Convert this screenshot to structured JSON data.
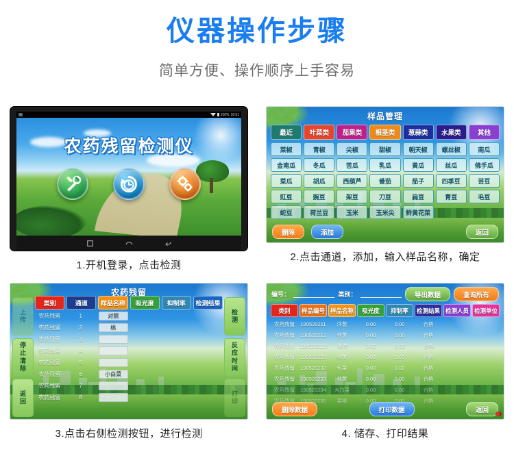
{
  "header": {
    "title": "仪器操作步骤",
    "subtitle": "简单方便、操作顺序上手容易",
    "title_color": "#1a7ef0"
  },
  "panel1": {
    "caption": "1.开机登录，点击检测",
    "screen_title": "农药残留检测仪",
    "status": {
      "battery": "100%",
      "time": "16:01"
    },
    "icons": [
      {
        "name": "tools-icon",
        "color": "#1f9a4a"
      },
      {
        "name": "history-clock-icon",
        "color": "#0c7fc4"
      },
      {
        "name": "settings-gears-icon",
        "color": "#e06c12"
      }
    ],
    "navbar": [
      "recents-icon",
      "home-icon",
      "back-icon"
    ]
  },
  "panel2": {
    "caption": "2.点击通道，添加，输入样品名称，确定",
    "title": "样品管理",
    "tabs": [
      {
        "label": "最近",
        "color": "#1f7a6e"
      },
      {
        "label": "叶菜类",
        "color": "#e8442c"
      },
      {
        "label": "茄果类",
        "color": "#c01f8a"
      },
      {
        "label": "根茎类",
        "color": "#f08a17"
      },
      {
        "label": "葱蒜类",
        "color": "#1b2f9e"
      },
      {
        "label": "水果类",
        "color": "#2a1b8e"
      },
      {
        "label": "其他",
        "color": "#8a3fd1"
      }
    ],
    "samples": [
      "菜椒",
      "青椒",
      "尖椒",
      "甜椒",
      "朝天椒",
      "螺丝椒",
      "南瓜",
      "金南瓜",
      "冬瓜",
      "苦瓜",
      "乳瓜",
      "黄瓜",
      "丝瓜",
      "佛手瓜",
      "菜瓜",
      "胡瓜",
      "西葫芦",
      "番茄",
      "茄子",
      "四季豆",
      "芸豆",
      "豇豆",
      "豌豆",
      "架豆",
      "刀豆",
      "扁豆",
      "青豆",
      "毛豆",
      "蛇豆",
      "荷兰豆",
      "玉米",
      "玉米尖",
      "鲜黄花菜"
    ],
    "buttons": {
      "delete": "删除",
      "add": "添加",
      "back": "返回"
    }
  },
  "panel3": {
    "caption": "3.点击右侧检测按钮，进行检测",
    "title": "农药残留",
    "left_buttons": [
      {
        "label": "上传",
        "faded": true
      },
      {
        "label": "停止清除",
        "faded": false
      },
      {
        "label": "返回",
        "faded": false
      }
    ],
    "right_buttons": [
      {
        "label": "检测",
        "faded": false
      },
      {
        "label": "反应时间",
        "faded": false
      },
      {
        "label": "打印",
        "faded": true
      }
    ],
    "headers": [
      {
        "label": "类别",
        "color": "#e2261c"
      },
      {
        "label": "通道",
        "color": "#1b3d8f"
      },
      {
        "label": "样品名称",
        "color": "#f29116"
      },
      {
        "label": "吸光度",
        "color": "#36a03c"
      },
      {
        "label": "抑制率",
        "color": "#2f87b5"
      },
      {
        "label": "检测结果",
        "color": "#1866c4"
      }
    ],
    "rows": [
      {
        "category": "农药残留",
        "channel": "1",
        "sample": "对照",
        "absorbance": "",
        "inhibition": "",
        "result": ""
      },
      {
        "category": "农药残留",
        "channel": "2",
        "sample": "桃",
        "absorbance": "",
        "inhibition": "",
        "result": ""
      },
      {
        "category": "农药残留",
        "channel": "3",
        "sample": "",
        "absorbance": "",
        "inhibition": "",
        "result": ""
      },
      {
        "category": "农药残留",
        "channel": "4",
        "sample": "",
        "absorbance": "",
        "inhibition": "",
        "result": ""
      },
      {
        "category": "农药残留",
        "channel": "5",
        "sample": "",
        "absorbance": "",
        "inhibition": "",
        "result": ""
      },
      {
        "category": "农药残留",
        "channel": "6",
        "sample": "小白菜",
        "absorbance": "",
        "inhibition": "",
        "result": ""
      },
      {
        "category": "农药残留",
        "channel": "7",
        "sample": "",
        "absorbance": "",
        "inhibition": "",
        "result": ""
      },
      {
        "category": "农药残留",
        "channel": "8",
        "sample": "",
        "absorbance": "",
        "inhibition": "",
        "result": ""
      }
    ]
  },
  "panel4": {
    "caption": "4. 储存、打印结果",
    "filters": {
      "number_label": "编号：",
      "number_value": "",
      "category_label": "类别：",
      "category_value": ""
    },
    "top_buttons": {
      "export": "导出数据",
      "query_all": "查询所有"
    },
    "headers": [
      {
        "label": "类别",
        "color": "#e2261c"
      },
      {
        "label": "样品编号",
        "color": "#e8711a"
      },
      {
        "label": "样品名称",
        "color": "#f0941c"
      },
      {
        "label": "吸光度",
        "color": "#36a03c"
      },
      {
        "label": "抑制率",
        "color": "#2f87b5"
      },
      {
        "label": "检测结果",
        "color": "#2b2f9e"
      },
      {
        "label": "检测人员",
        "color": "#8a3fd1"
      },
      {
        "label": "检测单位",
        "color": "#e0339c"
      }
    ],
    "rows": [
      {
        "category": "农药残留",
        "sample_no": "190520211",
        "sample": "洋葱",
        "absorbance": "0.00",
        "inhibition": "0.00",
        "result": "合格",
        "inspector": "",
        "unit": ""
      },
      {
        "category": "农药残留",
        "sample_no": "190520212",
        "sample": "韭黄",
        "absorbance": "0.00",
        "inhibition": "0.00",
        "result": "合格",
        "inspector": "",
        "unit": ""
      },
      {
        "category": "农药残留",
        "sample_no": "1905202115",
        "sample": "韭黄",
        "absorbance": "0.00",
        "inhibition": "0.00",
        "result": "合格",
        "inspector": "",
        "unit": ""
      },
      {
        "category": "农药残留",
        "sample_no": "190520229",
        "sample": "韭黄",
        "absorbance": "0.00",
        "inhibition": "0.00",
        "result": "合格",
        "inspector": "",
        "unit": ""
      },
      {
        "category": "农药残留",
        "sample_no": "190520232",
        "sample": "包菜",
        "absorbance": "0.00",
        "inhibition": "0.00",
        "result": "合格",
        "inspector": "",
        "unit": ""
      },
      {
        "category": "农药残留",
        "sample_no": "190520233",
        "sample": "韭黄",
        "absorbance": "0.00",
        "inhibition": "0.00",
        "result": "合格",
        "inspector": "",
        "unit": ""
      },
      {
        "category": "农药残留",
        "sample_no": "190520234",
        "sample": "大白菜",
        "absorbance": "0.00",
        "inhibition": "0.00",
        "result": "合格",
        "inspector": "",
        "unit": ""
      },
      {
        "category": "农药残留",
        "sample_no": "190520235",
        "sample": "菜椒",
        "absorbance": "0.00",
        "inhibition": "0.00",
        "result": "合格",
        "inspector": "",
        "unit": ""
      }
    ],
    "bottom_buttons": {
      "delete": "删除数据",
      "print": "打印数据",
      "back": "返回"
    }
  }
}
